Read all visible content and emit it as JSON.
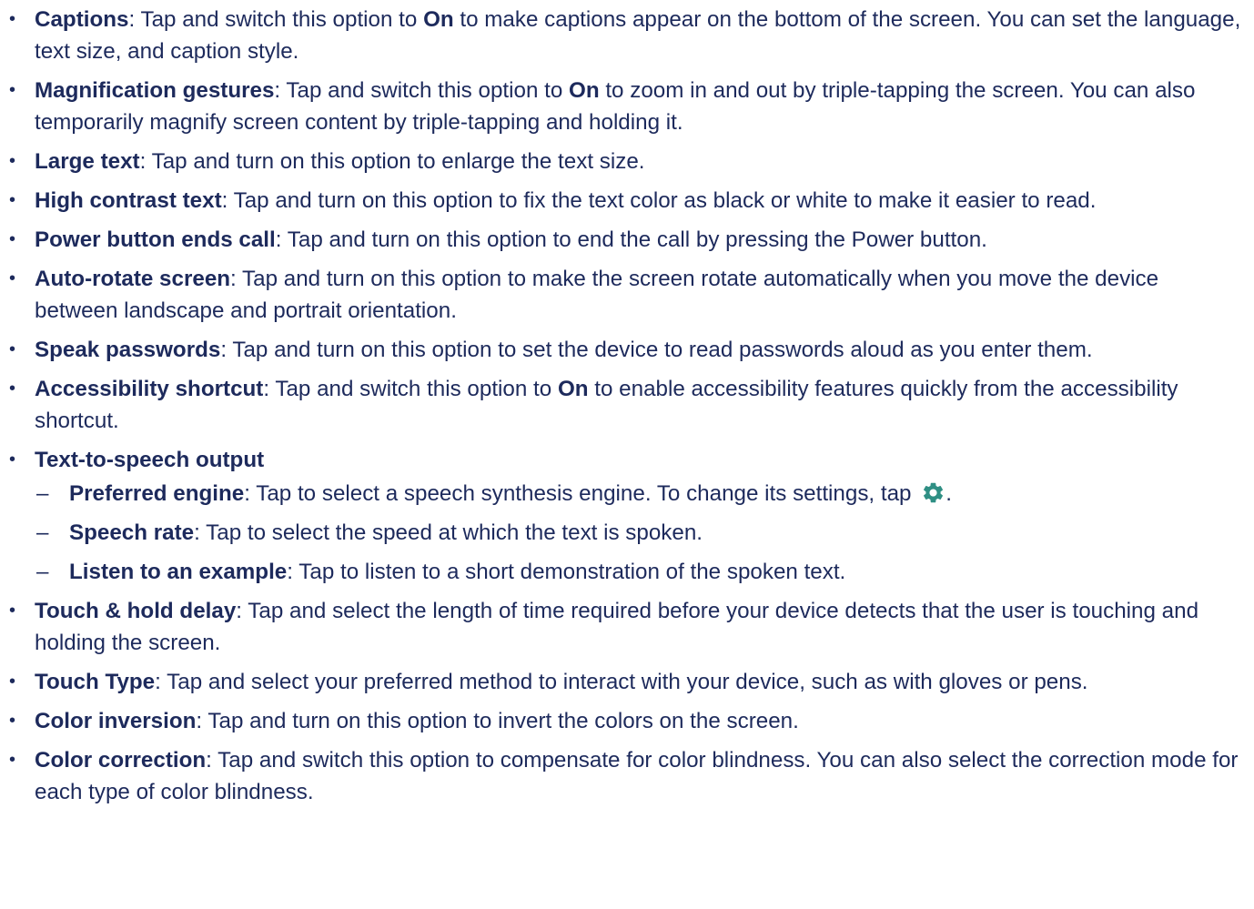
{
  "items": [
    {
      "term": "Captions",
      "pre": ": Tap and switch this option to ",
      "kw": "On",
      "post": " to make captions appear on the bottom of the screen. You can set the language, text size, and caption style."
    },
    {
      "term": "Magnification gestures",
      "pre": ": Tap and switch this option to ",
      "kw": "On",
      "post": " to zoom in and out by triple-tapping the screen. You can also temporarily magnify screen content by triple-tapping and holding it."
    },
    {
      "term": "Large text",
      "desc": ": Tap and turn on this option to enlarge the text size."
    },
    {
      "term": "High contrast text",
      "desc": ": Tap and turn on this option to fix the text color as black or white to make it easier to read."
    },
    {
      "term": "Power button ends call",
      "desc": ": Tap and turn on this option to end the call by pressing the Power button."
    },
    {
      "term": "Auto-rotate screen",
      "desc": ": Tap and turn on this option to make the screen rotate automatically when you move the device between landscape and portrait orientation."
    },
    {
      "term": "Speak passwords",
      "desc": ": Tap and turn on this option to set the device to read passwords aloud as you enter them."
    },
    {
      "term": "Accessibility shortcut",
      "pre": ": Tap and switch this option to ",
      "kw": "On",
      "post": " to enable accessibility features quickly from the accessibility shortcut."
    },
    {
      "term": "Text-to-speech output"
    },
    {
      "term": "Touch & hold delay",
      "desc": ": Tap and select the length of time required before your device detects that the user is touching and holding the screen."
    },
    {
      "term": "Touch Type",
      "desc": ": Tap and select your preferred method to interact with your device, such as with gloves or pens."
    },
    {
      "term": "Color inversion",
      "desc": ": Tap and turn on this option to invert the colors on the screen."
    },
    {
      "term": "Color correction",
      "desc": ": Tap and switch this option to compensate for color blindness. You can also select the correction mode for each type of color blindness."
    }
  ],
  "tts_sub": [
    {
      "term": "Preferred engine",
      "desc": ": Tap to select a speech synthesis engine. To change its settings, tap ",
      "end": "."
    },
    {
      "term": "Speech rate",
      "desc": ": Tap to select the speed at which the text is spoken."
    },
    {
      "term": "Listen to an example",
      "desc": ": Tap to listen to a short demonstration of the spoken text."
    }
  ],
  "bullet_char": "•",
  "dash_char": "–",
  "icons": {
    "settings": "gear-icon"
  },
  "colors": {
    "text": "#1d2a5c",
    "icon": "#2f8f84"
  }
}
